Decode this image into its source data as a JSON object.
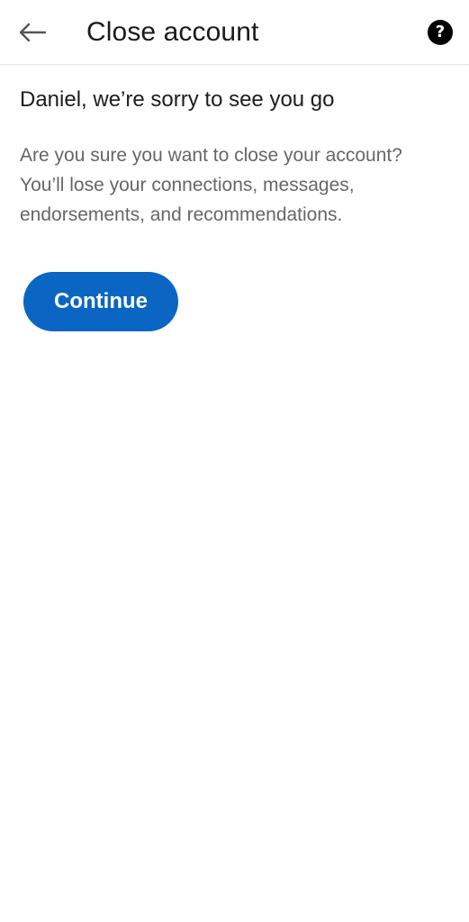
{
  "header": {
    "title": "Close account",
    "back_icon": "arrow-left-icon",
    "help_icon": "question-circle-icon",
    "help_glyph": "?"
  },
  "main": {
    "heading": "Daniel, we’re sorry to see you go",
    "body": "Are you sure you want to close your account? You’ll lose your connections, messages, endorsements, and recommendations.",
    "continue_label": "Continue"
  },
  "colors": {
    "accent": "#0a66c2",
    "body_text": "#666666",
    "title_text": "#1a1a1a"
  }
}
